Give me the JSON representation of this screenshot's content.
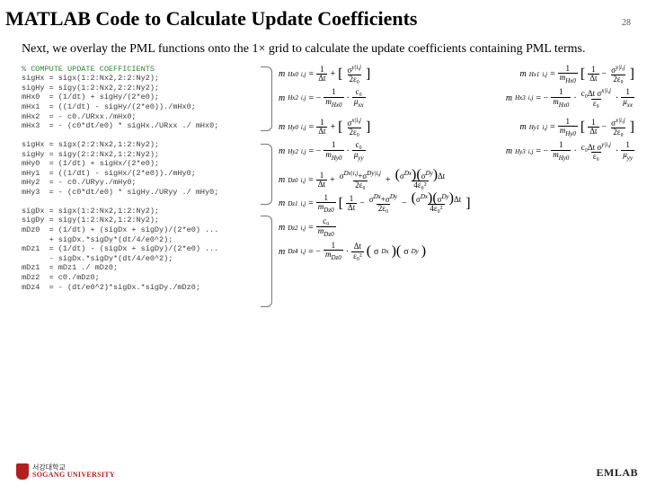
{
  "page_number": "28",
  "title": "MATLAB Code to Calculate Update Coefficients",
  "intro": "Next, we overlay the PML functions onto the 1× grid to calculate the update coefficients containing PML terms.",
  "code": {
    "comment": "% COMPUTE UPDATE COEFFICIENTS",
    "block1": "sigHx = sigx(1:2:Nx2,2:2:Ny2);\nsigHy = sigy(1:2:Nx2,2:2:Ny2);\nmHx0  = (1/dt) + sigHy/(2*e0);\nmHx1  = ((1/dt) - sigHy/(2*e0))./mHx0;\nmHx2  = - c0./URxx./mHx0;\nmHx3  = - (c0*dt/e0) * sigHx./URxx ./ mHx0;",
    "block2": "sigHx = sigx(2:2:Nx2,1:2:Ny2);\nsigHy = sigy(2:2:Nx2,1:2:Ny2);\nmHy0  = (1/dt) + sigHx/(2*e0);\nmHy1  = ((1/dt) - sigHx/(2*e0))./mHy0;\nmHy2  = - c0./URyy./mHy0;\nmHy3  = - (c0*dt/e0) * sigHy./URyy ./ mHy0;",
    "block3": "sigDx = sigx(1:2:Nx2,1:2:Ny2);\nsigDy = sigy(1:2:Nx2,1:2:Ny2);\nmDz0  = (1/dt) + (sigDx + sigDy)/(2*e0) ...\n      + sigDx.*sigDy*(dt/4/e0^2);\nmDz1  = (1/dt) - (sigDx + sigDy)/(2*e0) ...\n      - sigDx.*sigDy*(dt/4/e0^2);\nmDz1  = mDz1 ./ mDz0;\nmDz2  = c0./mDz0;\nmDz4  = - (dt/e0^2)*sigDx.*sigDy./mDz0;"
  },
  "math": {
    "hx": {
      "m0_lhs": "m",
      "m0_sub": "Hx0",
      "m0_rhs_a": "1",
      "m0_rhs_b": "Δt",
      "m0_rhs_c": "σ",
      "m0_rhs_d": "2ε₀",
      "m1_lhs": "m",
      "m1_sub": "Hx1",
      "m1_rhs_a": "1",
      "m1_rhs_b": "m",
      "m1_rhs_c": "1",
      "m1_rhs_d": "Δt",
      "m1_rhs_e": "σ",
      "m1_rhs_f": "2ε₀",
      "m2_lhs": "m",
      "m2_sub": "Hx2",
      "m2_rhs_a": "1",
      "m2_rhs_b": "m",
      "m2_rhs_c": "c₀",
      "m2_rhs_d": "μ",
      "m3_lhs": "m",
      "m3_sub": "Hx3",
      "m3_rhs_a": "1",
      "m3_rhs_b": "m",
      "m3_rhs_c": "c₀Δt σ",
      "m3_rhs_d": "ε₀",
      "m3_rhs_e": "μ"
    },
    "hy": {
      "m0_sub": "Hy0",
      "m1_sub": "Hy1",
      "m2_sub": "Hy2",
      "m3_sub": "Hy3"
    },
    "dz": {
      "m0_sub": "Dz0",
      "m0_rhs_a": "1",
      "m0_rhs_b": "Δt",
      "m0_plus": "σ",
      "m0_den": "2ε₀",
      "m0_tail_num": "σ",
      "m0_tail_den": "4ε₀²",
      "m1_sub": "Dz1",
      "m1_rhs": "1",
      "m1_den": "m",
      "m1_brk_a": "1",
      "m1_brk_b": "Δt",
      "m1_mid": "σ",
      "m1_mid_den": "2ε₀",
      "m1_tail": "σ",
      "m1_tail_den": "4ε₀²",
      "m2_sub": "Dz2",
      "m2_rhs": "c₀",
      "m2_den": "m",
      "m4_sub": "Dz4",
      "m4_rhs_a": "1",
      "m4_rhs_b": "m",
      "m4_num": "Δt",
      "m4_den": "ε₀²",
      "m4_sig": "σ"
    }
  },
  "footer": {
    "uni_kor": "서강대학교",
    "uni_eng": "SOGANG UNIVERSITY",
    "lab": "EMLAB"
  }
}
